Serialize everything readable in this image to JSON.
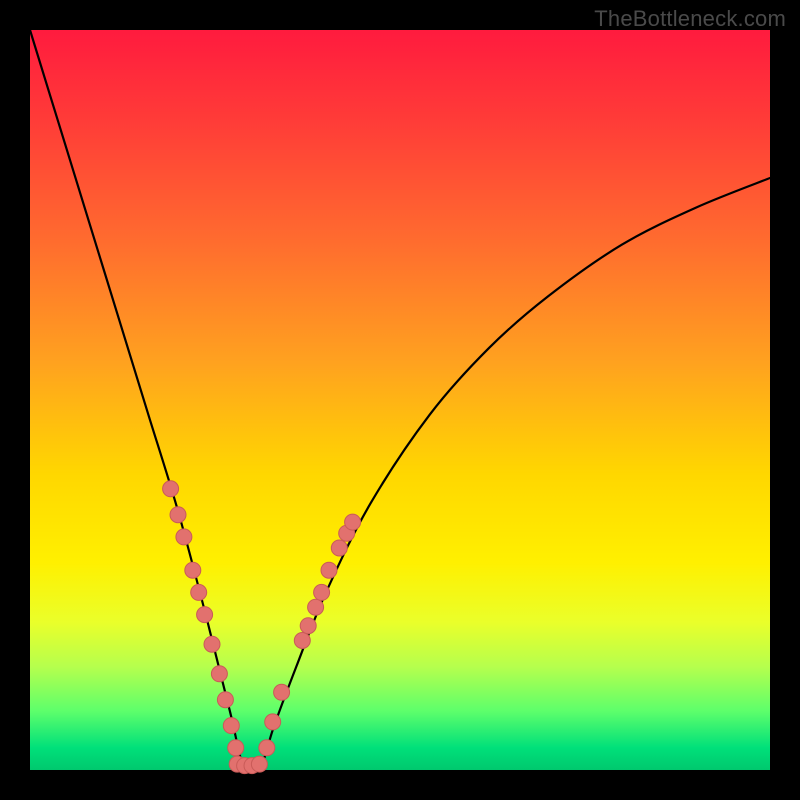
{
  "watermark": "TheBottleneck.com",
  "colors": {
    "frame": "#000000",
    "curve_stroke": "#000000",
    "dot_fill": "#e2716e",
    "dot_stroke": "#c95b58"
  },
  "chart_data": {
    "type": "line",
    "title": "",
    "xlabel": "",
    "ylabel": "",
    "xlim": [
      0,
      100
    ],
    "ylim": [
      0,
      100
    ],
    "description": "V-shaped bottleneck curve over rainbow gradient background; minimum near x≈29 with y≈0; pink dots cluster near the valley.",
    "series": [
      {
        "name": "bottleneck-curve",
        "x": [
          0,
          4,
          8,
          12,
          16,
          20,
          24,
          27,
          29,
          31,
          33,
          36,
          40,
          46,
          54,
          62,
          70,
          80,
          90,
          100
        ],
        "y": [
          100,
          87,
          74,
          61,
          48,
          35,
          20,
          8,
          0,
          0,
          6,
          14,
          24,
          36,
          48,
          57,
          64,
          71,
          76,
          80
        ]
      }
    ],
    "dots": [
      {
        "x": 19.0,
        "y": 38.0
      },
      {
        "x": 20.0,
        "y": 34.5
      },
      {
        "x": 20.8,
        "y": 31.5
      },
      {
        "x": 22.0,
        "y": 27.0
      },
      {
        "x": 22.8,
        "y": 24.0
      },
      {
        "x": 23.6,
        "y": 21.0
      },
      {
        "x": 24.6,
        "y": 17.0
      },
      {
        "x": 25.6,
        "y": 13.0
      },
      {
        "x": 26.4,
        "y": 9.5
      },
      {
        "x": 27.2,
        "y": 6.0
      },
      {
        "x": 27.8,
        "y": 3.0
      },
      {
        "x": 28.0,
        "y": 0.8
      },
      {
        "x": 29.0,
        "y": 0.6
      },
      {
        "x": 30.0,
        "y": 0.6
      },
      {
        "x": 31.0,
        "y": 0.8
      },
      {
        "x": 32.0,
        "y": 3.0
      },
      {
        "x": 32.8,
        "y": 6.5
      },
      {
        "x": 34.0,
        "y": 10.5
      },
      {
        "x": 36.8,
        "y": 17.5
      },
      {
        "x": 37.6,
        "y": 19.5
      },
      {
        "x": 38.6,
        "y": 22.0
      },
      {
        "x": 39.4,
        "y": 24.0
      },
      {
        "x": 40.4,
        "y": 27.0
      },
      {
        "x": 41.8,
        "y": 30.0
      },
      {
        "x": 42.8,
        "y": 32.0
      },
      {
        "x": 43.6,
        "y": 33.5
      }
    ]
  }
}
